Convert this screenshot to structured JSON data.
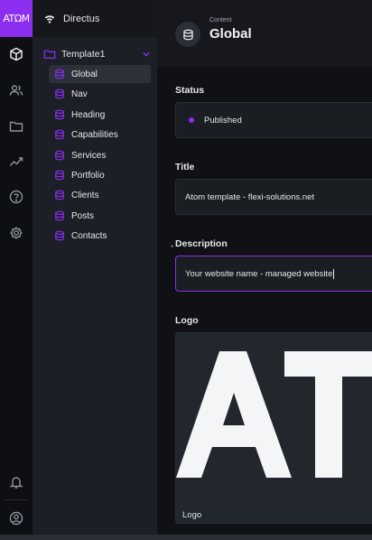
{
  "brand": {
    "logo_text": "ATΩM",
    "accent": "#8b2ef0"
  },
  "modules": [
    {
      "name": "content",
      "icon": "box-icon",
      "active": true
    },
    {
      "name": "users",
      "icon": "users-icon"
    },
    {
      "name": "files",
      "icon": "folder-icon"
    },
    {
      "name": "insights",
      "icon": "insights-icon"
    },
    {
      "name": "docs",
      "icon": "help-icon"
    },
    {
      "name": "settings",
      "icon": "gear-icon"
    },
    {
      "name": "notifications",
      "icon": "bell-icon"
    },
    {
      "name": "account",
      "icon": "account-icon"
    }
  ],
  "nav": {
    "project_name": "Directus",
    "folder": {
      "label": "Template1",
      "icon": "folder-icon"
    },
    "items": [
      {
        "label": "Global",
        "active": true
      },
      {
        "label": "Nav"
      },
      {
        "label": "Heading"
      },
      {
        "label": "Capabilities"
      },
      {
        "label": "Services"
      },
      {
        "label": "Portfolio"
      },
      {
        "label": "Clients"
      },
      {
        "label": "Posts"
      },
      {
        "label": "Contacts"
      }
    ]
  },
  "header": {
    "breadcrumb": "Content",
    "title": "Global",
    "icon": "database-icon"
  },
  "form": {
    "status": {
      "label": "Status",
      "value": "Published",
      "dot_color": "#8b2ef0"
    },
    "title": {
      "label": "Title",
      "value": "Atom template - flexi-solutions.net"
    },
    "description": {
      "label": "Description",
      "value": "Your website name - managed website",
      "required_marker": "*"
    },
    "logo": {
      "label": "Logo",
      "image_text": "AT",
      "caption": "Logo"
    }
  }
}
